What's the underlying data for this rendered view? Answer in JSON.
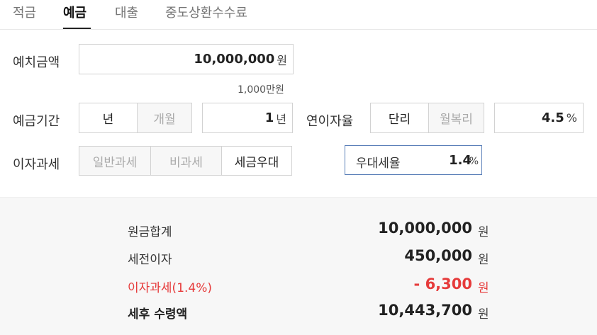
{
  "tabs": [
    {
      "label": "적금",
      "active": false
    },
    {
      "label": "예금",
      "active": true
    },
    {
      "label": "대출",
      "active": false
    },
    {
      "label": "중도상환수수료",
      "active": false
    }
  ],
  "deposit": {
    "label": "예치금액",
    "value": "10,000,000",
    "unit": "원",
    "hint": "1,000만원"
  },
  "period": {
    "label": "예금기간",
    "options": [
      "년",
      "개월"
    ],
    "selected": "년",
    "value": "1",
    "unit": "년"
  },
  "rate": {
    "label": "연이자율",
    "options": [
      "단리",
      "월복리"
    ],
    "selected": "단리",
    "value": "4.5",
    "unit": "%"
  },
  "tax": {
    "label": "이자과세",
    "options": [
      "일반과세",
      "비과세",
      "세금우대"
    ],
    "selected": "세금우대",
    "preferential_label": "우대세율",
    "preferential_value": "1.4",
    "preferential_unit": "%"
  },
  "results": [
    {
      "label": "원금합계",
      "value": "10,000,000",
      "unit": "원"
    },
    {
      "label": "세전이자",
      "value": "450,000",
      "unit": "원"
    },
    {
      "label": "이자과세(1.4%)",
      "value": "- 6,300",
      "unit": "원"
    },
    {
      "label": "세후 수령액",
      "value": "10,443,700",
      "unit": "원"
    }
  ],
  "colors": {
    "accent_red": "#e63b3b",
    "active_border": "#5a7fb8"
  }
}
